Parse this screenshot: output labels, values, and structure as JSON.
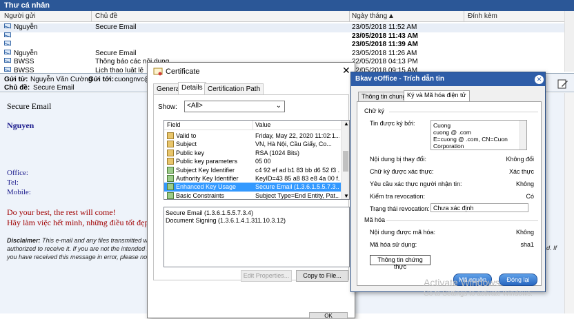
{
  "inbox": {
    "title": "Thư cá nhân",
    "columns": {
      "sender": "Người gửi",
      "subject": "Chủ đề",
      "date": "Ngày tháng",
      "attach": "Đính kèm"
    },
    "rows": [
      {
        "sender": "Nguyễn",
        "subject": "Secure Email",
        "date": "23/05/2018 11:52 AM",
        "bold": false
      },
      {
        "sender": "",
        "subject": "",
        "date": "23/05/2018 11:43 AM",
        "bold": true
      },
      {
        "sender": "",
        "subject": "",
        "date": "23/05/2018 11:39 AM",
        "bold": true
      },
      {
        "sender": "Nguyễn",
        "subject": "Secure Email",
        "date": "23/05/2018 11:26 AM",
        "bold": false
      },
      {
        "sender": "BWSS",
        "subject": "Thông báo các nội dung",
        "date": "22/05/2018 04:13 PM",
        "bold": false
      },
      {
        "sender": "BWSS",
        "subject": "Lịch thao luật lệ",
        "date": "22/05/2018 09:15 AM",
        "bold": false
      }
    ]
  },
  "reading": {
    "from_label": "Gửi từ:",
    "from_value": "Nguyễn Văn Cường",
    "to_label": "Gửi tới:",
    "to_value": "cuongnvc@b",
    "subject_label": "Chủ đề:",
    "subject_value": "Secure Email",
    "body_title": "Secure Email",
    "sender_name": "Nguyen",
    "office_label": "Office:",
    "tel_label": "Tel:",
    "mobile_label": "Mobile:",
    "quote1": "Do your best, the rest will come!",
    "quote2": "Hãy làm việc hết mình, những điều tốt đẹp sẽ",
    "disclaimer_label": "Disclaimer:",
    "disclaimer_l1": " This e-mail and any files transmitted wit",
    "disclaimer_l2": "authorized to receive it. If you are not the intended r",
    "disclaimer_l3": "you have received this message in error, please noti",
    "right_fragment": "d. If"
  },
  "cert": {
    "title": "Certificate",
    "tabs": [
      "General",
      "Details",
      "Certification Path"
    ],
    "active_tab": 1,
    "show_label": "Show:",
    "show_value": "<All>",
    "field_col": "Field",
    "value_col": "Value",
    "fields": [
      {
        "name": "Valid to",
        "value": "Friday, May 22, 2020 11:02:1...",
        "selected": false
      },
      {
        "name": "Subject",
        "value": "VN, Hà Nội, Cầu Giấy,       Co...",
        "selected": false
      },
      {
        "name": "Public key",
        "value": "RSA (1024 Bits)",
        "selected": false
      },
      {
        "name": "Public key parameters",
        "value": "05 00",
        "selected": false
      },
      {
        "name": "Subject Key Identifier",
        "value": "c4 92 ef ad b1 83 bb d6 52 f3 ...",
        "selected": false
      },
      {
        "name": "Authority Key Identifier",
        "value": "KeyID=43 85 a8 83 e8 4a 00 f...",
        "selected": false
      },
      {
        "name": "Enhanced Key Usage",
        "value": "Secure Email (1.3.6.1.5.5.7.3....",
        "selected": true
      },
      {
        "name": "Basic Constraints",
        "value": "Subject Type=End Entity, Pat...",
        "selected": false
      }
    ],
    "detail_lines": [
      "Secure Email (1.3.6.1.5.5.7.3.4)",
      "Document Signing (1.3.6.1.4.1.311.10.3.12)"
    ],
    "edit_properties": "Edit Properties...",
    "copy_to_file": "Copy to File...",
    "ok": "OK"
  },
  "eoffice": {
    "title": "Bkav eOffice - Trích dẫn tin",
    "tabs": [
      "Thông tin chung",
      "Ký và Mã hóa điện tử"
    ],
    "active_tab": 1,
    "sig_group": "Chữ ký",
    "signer_label": "Tin được ký bởi:",
    "signer_lines": [
      "Cuong",
      "cuong    @         .com",
      "E=cuong    @         .com, CN=Cuon",
      "        Corporation"
    ],
    "changed_label": "Nội dung bị thay đổi:",
    "changed_value": "Không đổi",
    "verified_label": "Chữ ký được xác thực:",
    "verified_value": "Xác thực",
    "confirm_label": "Yêu cầu xác thực người nhận tin:",
    "confirm_value": "Không",
    "revoc_check_label": "Kiểm tra revocation:",
    "revoc_check_value": "Có",
    "revoc_state_label": "Trạng thái revocation:",
    "revoc_state_value": "Chưa xác định",
    "enc_group": "Mã hóa",
    "encrypted_label": "Nội dung được mã hóa:",
    "encrypted_value": "Không",
    "cipher_label": "Mã hóa sử dụng:",
    "cipher_value": "sha1",
    "cert_info_btn": "Thông tin chứng thực",
    "source_btn": "Mã nguồn",
    "close_btn": "Đóng lại"
  },
  "watermark": {
    "line1": "Activate Windows",
    "line2": "Go to Settings to activate Windows."
  },
  "colors": {
    "title_blue": "#2b5797",
    "select_blue": "#3399ff",
    "quote_red": "#a00000",
    "name_blue": "#1a1a8c"
  }
}
